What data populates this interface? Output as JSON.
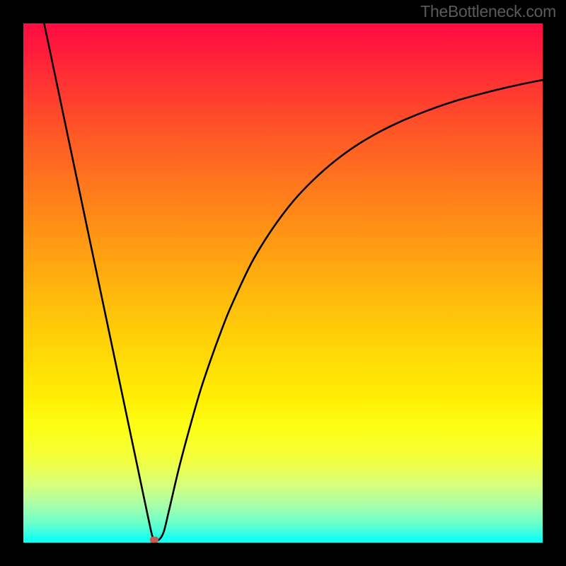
{
  "attribution": "TheBottleneck.com",
  "chart_data": {
    "type": "line",
    "title": "",
    "xlabel": "",
    "ylabel": "",
    "xlim": [
      0,
      100
    ],
    "ylim": [
      0,
      100
    ],
    "grid": false,
    "legend": false,
    "series": [
      {
        "name": "bottleneck-curve",
        "color": "#000000",
        "x": [
          4,
          6,
          8,
          10,
          12,
          14,
          16,
          18,
          20,
          22,
          24,
          25,
          26,
          27,
          28,
          30,
          32,
          34,
          36,
          38,
          40,
          44,
          48,
          52,
          56,
          60,
          64,
          68,
          72,
          76,
          80,
          84,
          88,
          92,
          96,
          100
        ],
        "y": [
          100,
          90.5,
          81,
          71.5,
          62,
          52.5,
          43,
          33.5,
          24,
          14.5,
          5,
          0.8,
          0.5,
          2,
          6,
          14.5,
          22,
          29,
          35,
          40.5,
          45.5,
          54,
          60.5,
          65.8,
          70,
          73.5,
          76.4,
          78.8,
          80.8,
          82.5,
          84,
          85.3,
          86.4,
          87.4,
          88.3,
          89.1
        ]
      }
    ],
    "marker": {
      "x": 25.2,
      "y": 0.5,
      "color": "#cb5a4e"
    },
    "background_gradient": {
      "direction": "top-to-bottom",
      "stops": [
        {
          "pos": 0,
          "color": "#ff0b41"
        },
        {
          "pos": 14,
          "color": "#ff3c2f"
        },
        {
          "pos": 32,
          "color": "#ff7a1c"
        },
        {
          "pos": 52,
          "color": "#ffb80c"
        },
        {
          "pos": 72,
          "color": "#ffee04"
        },
        {
          "pos": 84,
          "color": "#f3ff3e"
        },
        {
          "pos": 93,
          "color": "#a3ffab"
        },
        {
          "pos": 100,
          "color": "#0cfff4"
        }
      ]
    }
  }
}
